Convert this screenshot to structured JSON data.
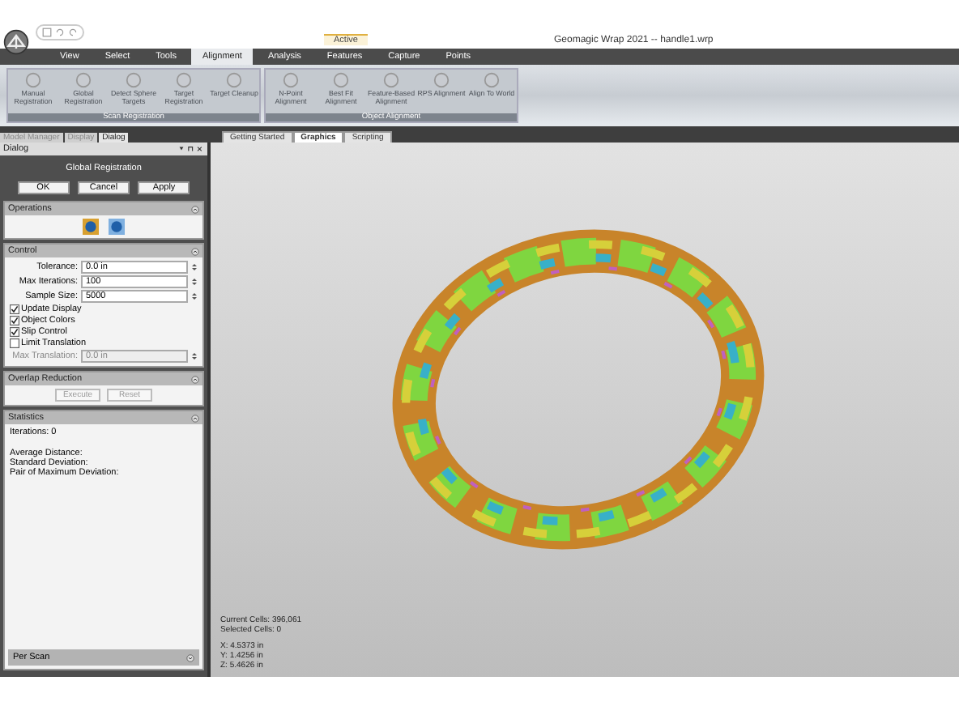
{
  "app": {
    "context_label": "Active",
    "title": "Geomagic Wrap 2021 -- handle1.wrp"
  },
  "menu_tabs": [
    {
      "label": "View",
      "selected": false
    },
    {
      "label": "Select",
      "selected": false
    },
    {
      "label": "Tools",
      "selected": false
    },
    {
      "label": "Alignment",
      "selected": true
    },
    {
      "label": "Analysis",
      "selected": false
    },
    {
      "label": "Features",
      "selected": false
    },
    {
      "label": "Capture",
      "selected": false
    },
    {
      "label": "Points",
      "selected": false
    }
  ],
  "ribbon_groups": [
    {
      "label": "Scan Registration",
      "buttons": [
        "Manual Registration",
        "Global Registration",
        "Detect Sphere Targets",
        "Target Registration",
        "Target Cleanup"
      ]
    },
    {
      "label": "Object Alignment",
      "buttons": [
        "N-Point Alignment",
        "Best Fit Alignment",
        "Feature-Based Alignment",
        "RPS Alignment",
        "Align To World"
      ]
    }
  ],
  "panel_tabs": [
    {
      "label": "Model Manager",
      "selected": false
    },
    {
      "label": "Display",
      "selected": false
    },
    {
      "label": "Dialog",
      "selected": true
    }
  ],
  "doc_tabs": [
    {
      "label": "Getting Started",
      "selected": false
    },
    {
      "label": "Graphics",
      "selected": true
    },
    {
      "label": "Scripting",
      "selected": false
    }
  ],
  "dialog": {
    "title": "Dialog",
    "heading": "Global Registration",
    "buttons": [
      "OK",
      "Cancel",
      "Apply"
    ],
    "operations": {
      "title": "Operations"
    },
    "control": {
      "title": "Control",
      "rows": [
        {
          "kind": "field",
          "label": "Tolerance:",
          "value": "0.0 in",
          "disabled": false
        },
        {
          "kind": "field",
          "label": "Max Iterations:",
          "value": "100",
          "disabled": false
        },
        {
          "kind": "field",
          "label": "Sample Size:",
          "value": "5000",
          "disabled": false
        },
        {
          "kind": "checkbox",
          "label": "Update Display",
          "checked": true
        },
        {
          "kind": "checkbox",
          "label": "Object Colors",
          "checked": true
        },
        {
          "kind": "checkbox",
          "label": "Slip Control",
          "checked": true
        },
        {
          "kind": "checkbox",
          "label": "Limit Translation",
          "checked": false
        },
        {
          "kind": "field",
          "label": "Max Translation:",
          "value": "0.0 in",
          "disabled": true
        }
      ]
    },
    "overlap": {
      "title": "Overlap Reduction",
      "buttons": [
        "Execute",
        "Reset"
      ],
      "disabled": true
    },
    "statistics": {
      "title": "Statistics",
      "line_groups": [
        [
          "Iterations: 0"
        ],
        [
          "Average Distance:",
          "Standard Deviation:",
          "Pair of Maximum Deviation:"
        ]
      ],
      "footer": "Per Scan"
    }
  },
  "viewport": {
    "info": [
      "Current Cells: 396,061",
      "Selected Cells: 0"
    ],
    "coords": [
      "X:  4.5373 in",
      "Y:  1.4256 in",
      "Z:  5.4626 in"
    ]
  }
}
